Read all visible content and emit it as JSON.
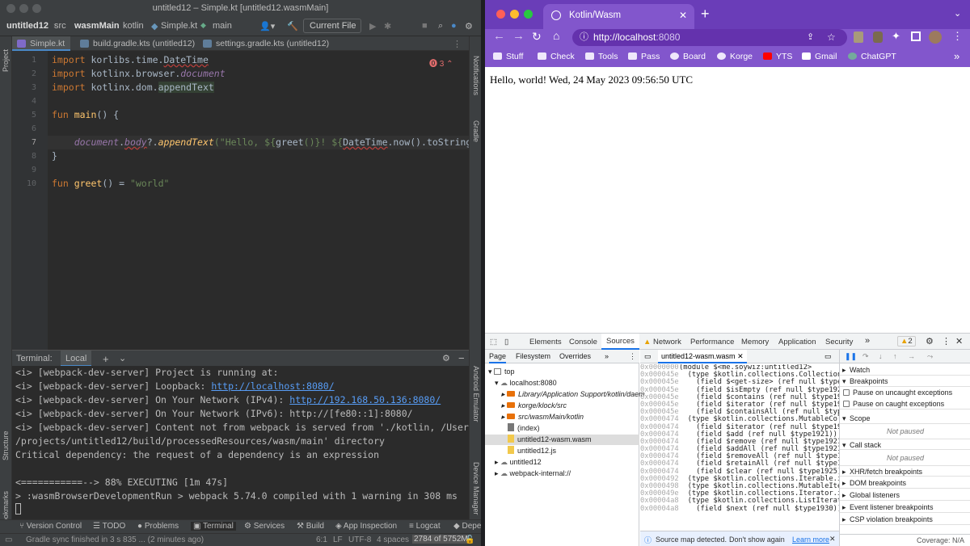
{
  "ide": {
    "window_title": "untitled12 – Simple.kt [untitled12.wasmMain]",
    "breadcrumbs": [
      "untitled12",
      "src",
      "wasmMain",
      "kotlin",
      "Simple.kt"
    ],
    "run_config": "main",
    "current_file_label": "Current File",
    "editor_tabs": [
      "Simple.kt",
      "build.gradle.kts (untitled12)",
      "settings.gradle.kts (untitled12)"
    ],
    "error_count": "3",
    "line_numbers": [
      "1",
      "2",
      "3",
      "4",
      "5",
      "6",
      "7",
      "8",
      "9",
      "10"
    ],
    "code": {
      "l1_kw": "import",
      "l1_pkg": " korlibs.time.",
      "l1_cls": "DateTime",
      "l2_kw": "import",
      "l2_pkg": " kotlinx.browser.",
      "l2_id": "document",
      "l3_kw": "import",
      "l3_pkg": " kotlinx.dom.",
      "l3_fn": "appendText",
      "l5_kw": "fun",
      "l5_fn": " main",
      "l5_rest": "() {",
      "l7_doc": "document",
      "l7_dot": ".",
      "l7_body": "body",
      "l7_q": "?.",
      "l7_fn": "appendText",
      "l7_str1": "(\"Hello, ${",
      "l7_greet": "greet",
      "l7_str2": "()}! ${",
      "l7_dt": "DateTime",
      "l7_rest": ".now().toStringDefault()",
      "l8_brace": "}",
      "l10_kw": "fun",
      "l10_fn": " greet",
      "l10_mid": "() = ",
      "l10_str": "\"world\""
    },
    "terminal": {
      "title": "Terminal:",
      "tab": "Local",
      "lines": [
        "<i> [webpack-dev-server] Project is running at:",
        "<i> [webpack-dev-server] Loopback: ",
        "<i> [webpack-dev-server] On Your Network (IPv4): ",
        "<i> [webpack-dev-server] On Your Network (IPv6): http://[fe80::1]:8080/",
        "<i> [webpack-dev-server] Content not from webpack is served from './kotlin, /Users/soywiz",
        "/projects/untitled12/build/processedResources/wasm/main' directory",
        "Critical dependency: the request of a dependency is an expression",
        "",
        "<===========--> 88% EXECUTING [1m 47s]",
        "> :wasmBrowserDevelopmentRun > webpack 5.74.0 compiled with 1 warning in 308 ms"
      ],
      "link_loopback": "http://localhost:8080/",
      "link_ipv4": "http://192.168.50.136:8080/"
    },
    "left_strip": [
      "Project",
      "Structure",
      "Bookmarks"
    ],
    "right_strip": [
      "Notifications",
      "Gradle",
      "Android Emulator",
      "Device Manager"
    ],
    "tool_windows": [
      "Version Control",
      "TODO",
      "Problems",
      "Terminal",
      "Services",
      "Build",
      "App Inspection",
      "Logcat",
      "Depe"
    ],
    "status": {
      "message": "Gradle sync finished in 3 s 835 ... (2 minutes ago)",
      "position": "6:1",
      "line_sep": "LF",
      "encoding": "UTF-8",
      "indent": "4 spaces",
      "memory": "2784 of 5752M"
    }
  },
  "browser": {
    "tab_title": "Kotlin/Wasm",
    "url_host": "http://localhost",
    "url_port": ":8080",
    "bookmarks": [
      "Stuff",
      "Check",
      "Tools",
      "Pass",
      "Board",
      "Korge",
      "YTS",
      "Gmail",
      "ChatGPT"
    ],
    "page_text": "Hello, world! Wed, 24 May 2023 09:56:50 UTC",
    "devtools": {
      "tabs": [
        "Elements",
        "Console",
        "Sources",
        "Network",
        "Performance",
        "Memory",
        "Application",
        "Security"
      ],
      "more": "»",
      "warnings": "2",
      "nav_tabs": [
        "Page",
        "Filesystem",
        "Overrides"
      ],
      "tree": [
        "top",
        "localhost:8080",
        "Library/Application Support/kotlin/daem",
        "korge/klock/src",
        "src/wasmMain/kotlin",
        "(index)",
        "untitled12-wasm.wasm",
        "untitled12.js",
        "untitled12",
        "webpack-internal://"
      ],
      "open_file": "untitled12-wasm.wasm",
      "source_lines": [
        [
          "0x0000000",
          "(module $<me.soywiz:untitled12>"
        ],
        [
          "0x000045e",
          "  (type $kotlin.collections.Collection.ita"
        ],
        [
          "0x000045e",
          "    (field $<get-size> (ref null $type1929"
        ],
        [
          "0x000045e",
          "    (field $isEmpty (ref null $type1929))"
        ],
        [
          "0x000045e",
          "    (field $contains (ref null $type1921))"
        ],
        [
          "0x000045e",
          "    (field $iterator (ref null $type1930))"
        ],
        [
          "0x000045e",
          "    (field $containsAll (ref null $type1921"
        ],
        [
          "0x0000474",
          "  (type $kotlin.collections.MutableCollect"
        ],
        [
          "0x0000474",
          "    (field $iterator (ref null $type1930))"
        ],
        [
          "0x0000474",
          "    (field $add (ref null $type1921))"
        ],
        [
          "0x0000474",
          "    (field $remove (ref null $type1921))"
        ],
        [
          "0x0000474",
          "    (field $addAll (ref null $type1921))"
        ],
        [
          "0x0000474",
          "    (field $removeAll (ref null $type1921)"
        ],
        [
          "0x0000474",
          "    (field $retainAll (ref null $type1921)"
        ],
        [
          "0x0000474",
          "    (field $clear (ref null $type1925)))"
        ],
        [
          "0x0000492",
          "  (type $kotlin.collections.Iterable.itab"
        ],
        [
          "0x0000498",
          "  (type $kotlin.collections.MutableIterab"
        ],
        [
          "0x000049e",
          "  (type $kotlin.collections.Iterator.itab"
        ],
        [
          "0x00004a8",
          "  (type $kotlin.collections.ListIterator.i"
        ],
        [
          "0x00004a8",
          "    (field $next (ref null $type1930))"
        ]
      ],
      "source_map_msg": "Source map detected.",
      "dont_show": "Don't show again",
      "learn_more": "Learn more",
      "coverage": "Coverage: N/A",
      "debugger": {
        "watch": "Watch",
        "breakpoints": "Breakpoints",
        "pause_uncaught": "Pause on uncaught exceptions",
        "pause_caught": "Pause on caught exceptions",
        "scope": "Scope",
        "not_paused": "Not paused",
        "call_stack": "Call stack",
        "xhr": "XHR/fetch breakpoints",
        "dom": "DOM breakpoints",
        "global": "Global listeners",
        "event": "Event listener breakpoints",
        "csp": "CSP violation breakpoints"
      }
    }
  },
  "colors": {
    "ide_bg": "#2b2b2b",
    "chrome_purple": "#6a3db8",
    "link_blue": "#589df6",
    "devtools_accent": "#1a73e8"
  }
}
